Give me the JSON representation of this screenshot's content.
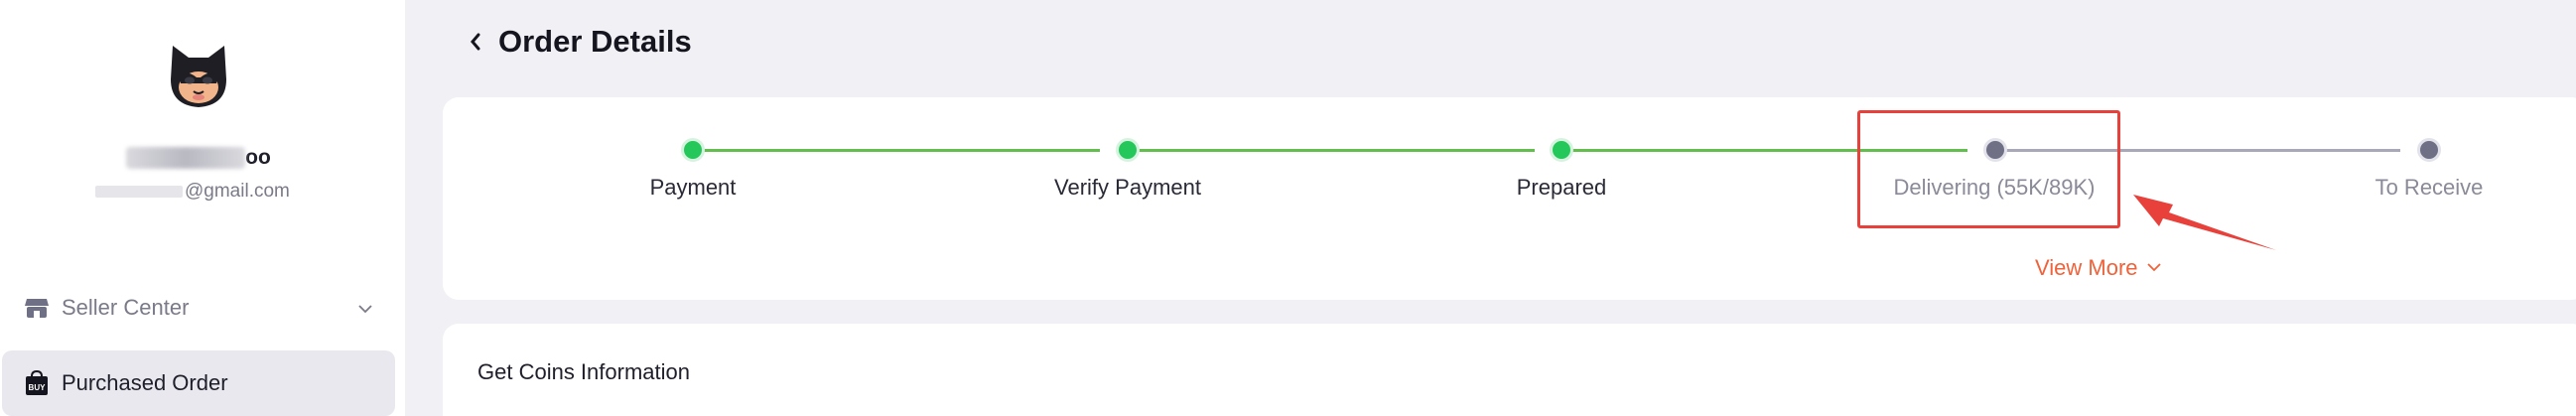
{
  "sidebar": {
    "username_visible": "oo",
    "email_suffix": "@gmail.com",
    "items": [
      {
        "label": "Seller Center",
        "icon": "store-icon"
      },
      {
        "label": "Purchased Order",
        "icon": "buy-bag-icon",
        "icon_text": "BUY"
      }
    ]
  },
  "page": {
    "title": "Order Details"
  },
  "progress": {
    "steps": [
      {
        "label": "Payment",
        "status": "completed"
      },
      {
        "label": "Verify Payment",
        "status": "completed"
      },
      {
        "label": "Prepared",
        "status": "completed"
      },
      {
        "label": "Delivering (55K/89K)",
        "status": "current"
      },
      {
        "label": "To Receive",
        "status": "pending"
      }
    ],
    "view_more": "View More"
  },
  "coins_section": {
    "title": "Get Coins Information"
  },
  "colors": {
    "completed": "#24c85a",
    "line_done": "#62bf4d",
    "pending": "#6f6f86",
    "accent": "#f0623a",
    "annotation": "#e8403a"
  }
}
